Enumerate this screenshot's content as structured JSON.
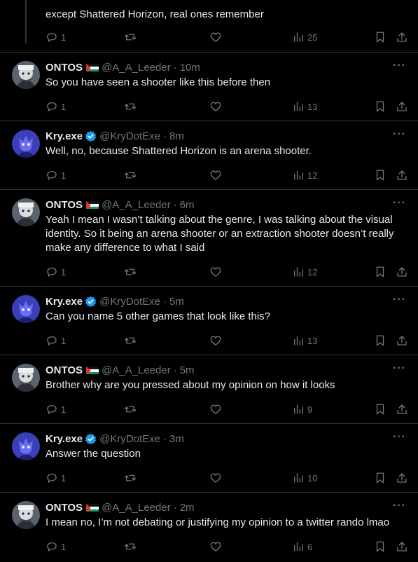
{
  "first_post": {
    "text": "except Shattered Horizon, real ones remember",
    "replies": "1",
    "views": "25"
  },
  "posts": [
    {
      "author": "ONTOS",
      "handle": "@A_A_Leeder",
      "time": "10m",
      "flag": true,
      "verified": false,
      "avatar": "ontos",
      "text": "So you have seen a shooter like this before then",
      "replies": "1",
      "views": "13"
    },
    {
      "author": "Kry.exe",
      "handle": "@KryDotExe",
      "time": "8m",
      "flag": false,
      "verified": true,
      "avatar": "kry",
      "text": "Well, no, because Shattered Horizon is an arena shooter.",
      "replies": "1",
      "views": "12"
    },
    {
      "author": "ONTOS",
      "handle": "@A_A_Leeder",
      "time": "6m",
      "flag": true,
      "verified": false,
      "avatar": "ontos",
      "text": "Yeah I mean I wasn’t talking about the genre, I was talking about the visual identity. So it being an arena shooter or an extraction shooter doesn’t really make any difference to what I said",
      "replies": "1",
      "views": "12"
    },
    {
      "author": "Kry.exe",
      "handle": "@KryDotExe",
      "time": "5m",
      "flag": false,
      "verified": true,
      "avatar": "kry",
      "text": "Can you name 5 other games that look like this?",
      "replies": "1",
      "views": "13"
    },
    {
      "author": "ONTOS",
      "handle": "@A_A_Leeder",
      "time": "5m",
      "flag": true,
      "verified": false,
      "avatar": "ontos",
      "text": "Brother why are you pressed about my opinion on how it looks",
      "replies": "1",
      "views": "9"
    },
    {
      "author": "Kry.exe",
      "handle": "@KryDotExe",
      "time": "3m",
      "flag": false,
      "verified": true,
      "avatar": "kry",
      "text": "Answer the question",
      "replies": "1",
      "views": "10"
    },
    {
      "author": "ONTOS",
      "handle": "@A_A_Leeder",
      "time": "2m",
      "flag": true,
      "verified": false,
      "avatar": "ontos",
      "text": "I mean no, I’m not debating or justifying my opinion to a twitter rando lmao",
      "replies": "1",
      "views": "6"
    }
  ],
  "separator": "·",
  "more_label": "···",
  "colors": {
    "background": "#000000",
    "text": "#e7e9ea",
    "muted": "#71767b",
    "verified": "#1d9bf0"
  },
  "icons": {
    "reply": "reply-icon",
    "repost": "repost-icon",
    "like": "like-icon",
    "views": "views-icon",
    "bookmark": "bookmark-icon",
    "share": "share-icon",
    "verified": "verified-badge-icon",
    "flag": "flag-icon"
  }
}
